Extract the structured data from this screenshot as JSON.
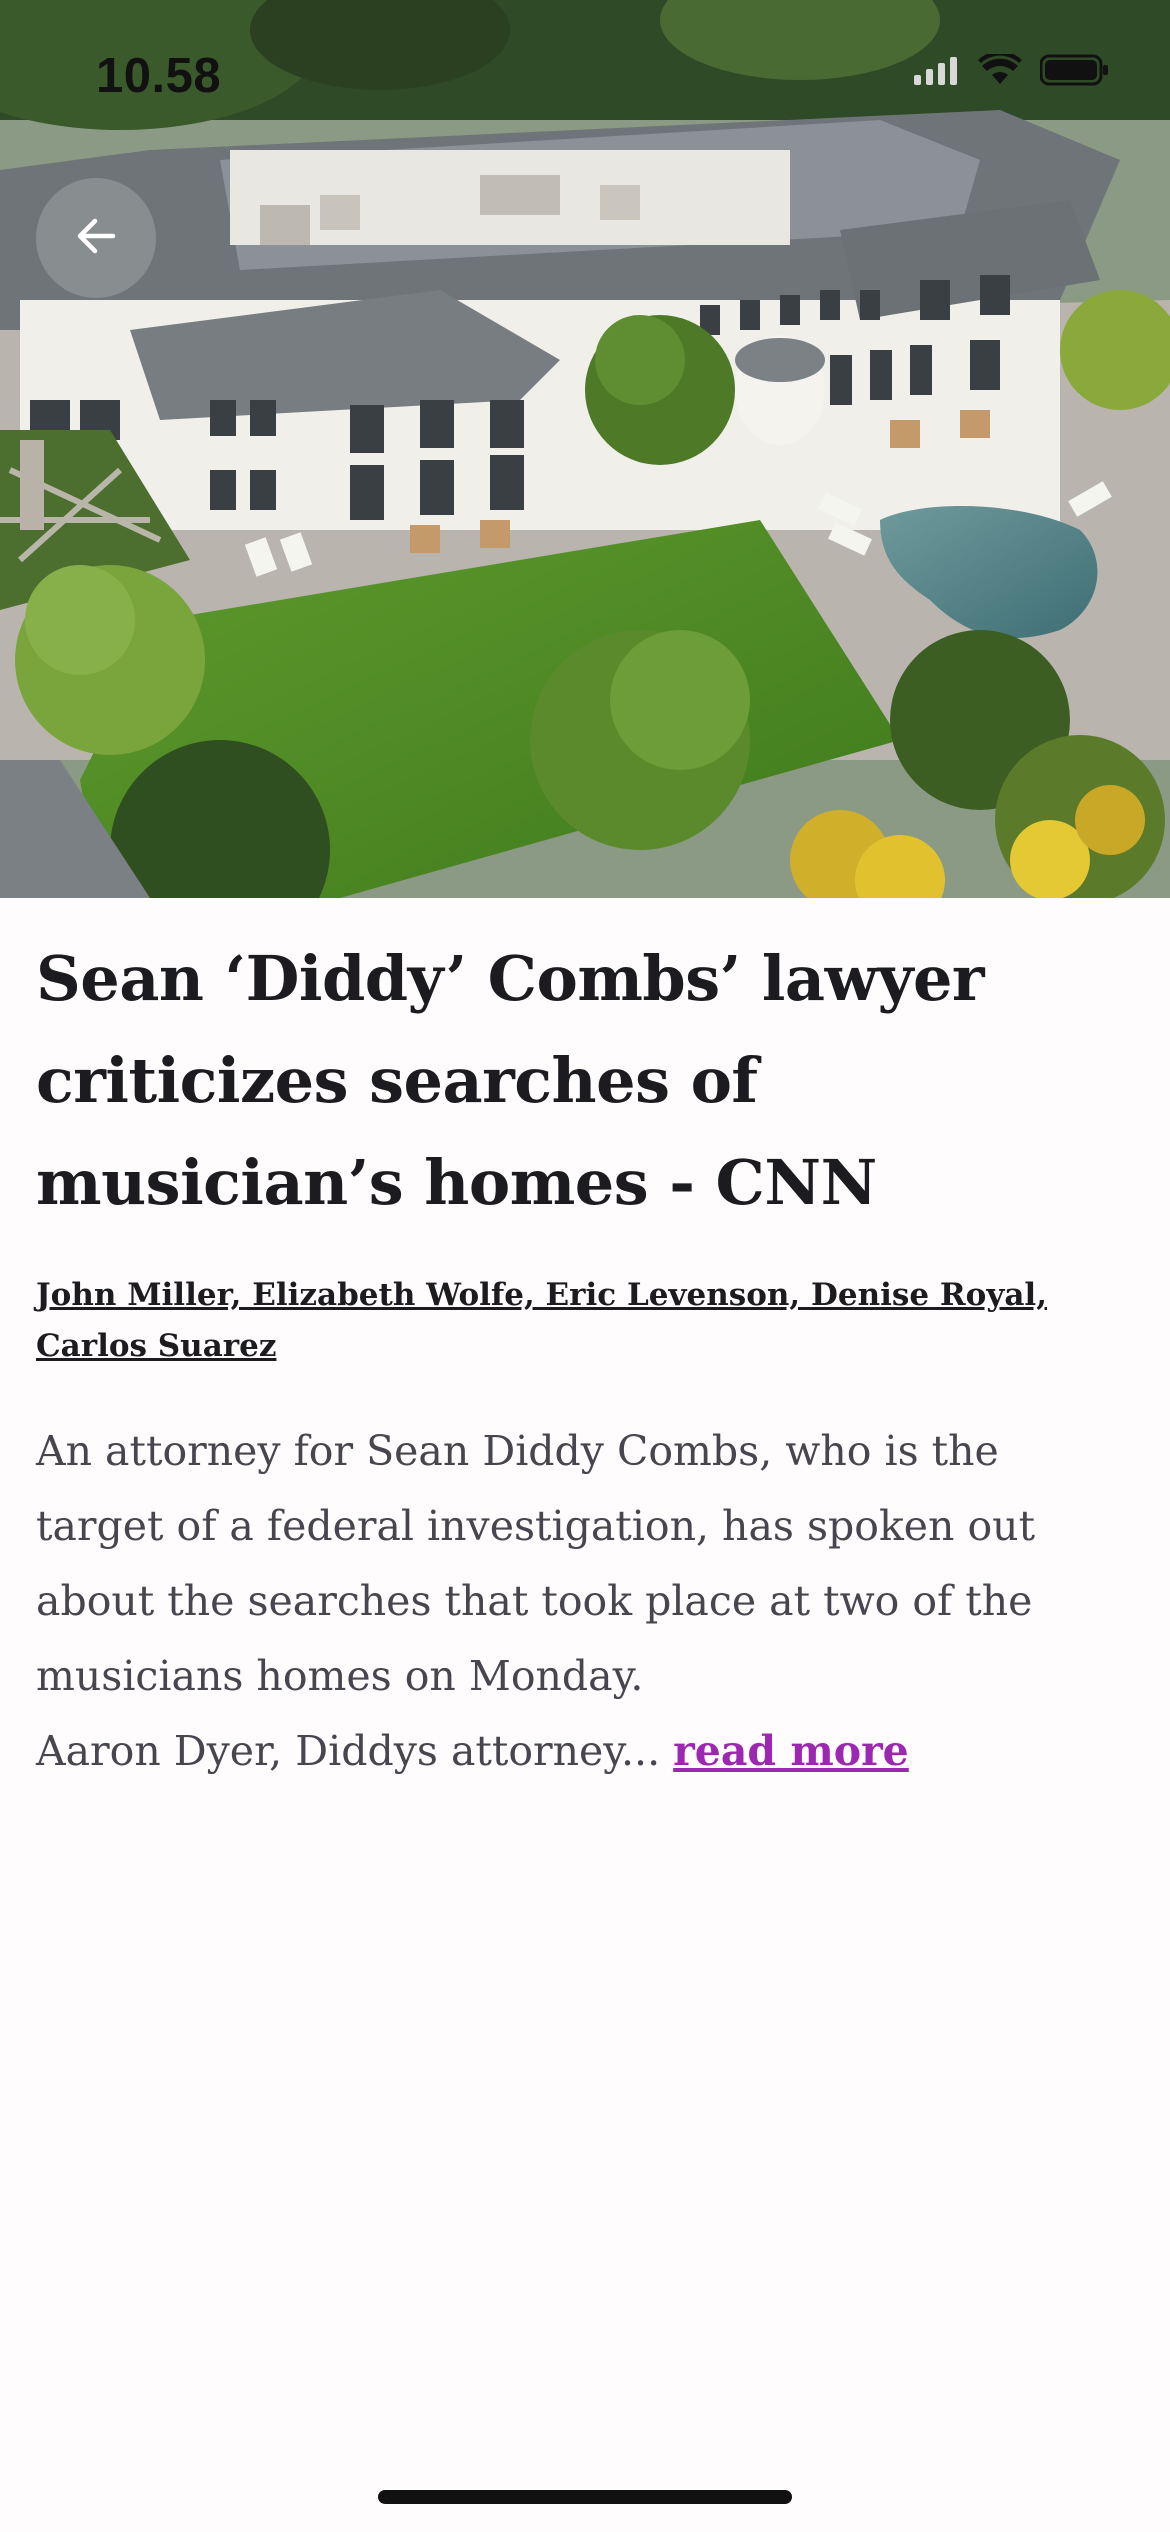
{
  "status_bar": {
    "time": "10.58"
  },
  "hero": {
    "image_icon": "mansion-aerial-photo",
    "back_icon": "arrow-left-icon"
  },
  "article": {
    "title": "Sean ‘Diddy’ Combs’ lawyer criticizes searches of musician’s homes - CNN",
    "authors": "John Miller, Elizabeth Wolfe, Eric Levenson, Denise Royal, Carlos Suarez",
    "summary_paragraph_1": "An attorney for Sean Diddy Combs, who is the target of a federal investigation, has spoken out about the searches that took place at two of the musicians homes on Monday.",
    "summary_paragraph_2": "Aaron Dyer, Diddys attorney...",
    "read_more_label": "read more"
  },
  "colors": {
    "background": "#fffcfe",
    "title_text": "#1c1b1f",
    "body_text": "#49454f",
    "link_accent": "#9c27b0"
  }
}
